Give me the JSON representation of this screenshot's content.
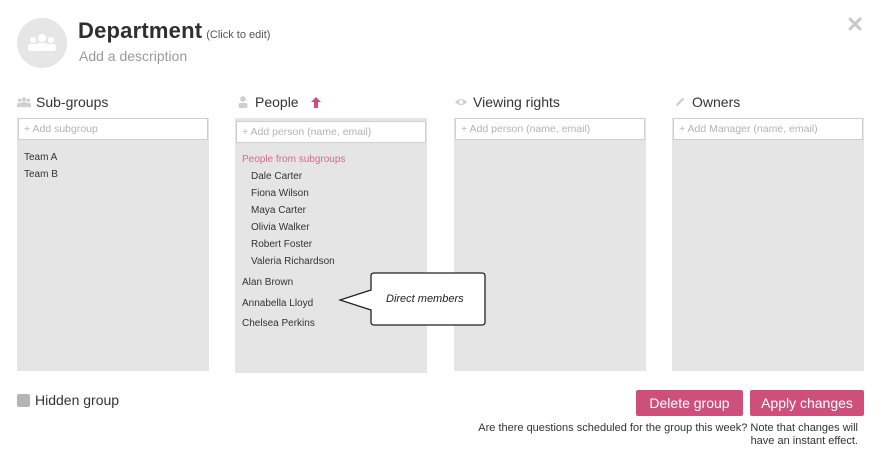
{
  "header": {
    "title": "Department",
    "click_to_edit": "(Click to edit)",
    "description": "Add a description",
    "close_icon": "close-x-icon"
  },
  "columns": {
    "subgroups": {
      "label": "Sub-groups",
      "icon": "people-group-icon",
      "placeholder": "+ Add subgroup",
      "items": [
        "Team A",
        "Team B"
      ]
    },
    "people": {
      "label": "People",
      "icon": "person-icon",
      "sort_icon": "arrow-up-icon",
      "placeholder": "+ Add person (name, email)",
      "subgroup_label": "People from subgroups",
      "from_subgroups": [
        "Dale Carter",
        "Fiona Wilson",
        "Maya Carter",
        "Olivia Walker",
        "Robert Foster",
        "Valeria Richardson"
      ],
      "direct_members": [
        "Alan Brown",
        "Annabella Lloyd",
        "Chelsea Perkins"
      ]
    },
    "viewing": {
      "label": "Viewing rights",
      "icon": "eye-icon",
      "placeholder": "+ Add person (name, email)"
    },
    "owners": {
      "label": "Owners",
      "icon": "pencil-icon",
      "placeholder": "+ Add Manager (name, email)"
    }
  },
  "callout": {
    "text": "Direct members"
  },
  "footer": {
    "hidden_group": "Hidden group",
    "delete_label": "Delete group",
    "apply_label": "Apply changes",
    "note": "Are there questions scheduled for the group this week? Note that changes will have an instant effect."
  },
  "colors": {
    "accent": "#cf4f7b",
    "subgroup_label": "#d66b8a",
    "panel_bg": "#e5e5e5"
  }
}
